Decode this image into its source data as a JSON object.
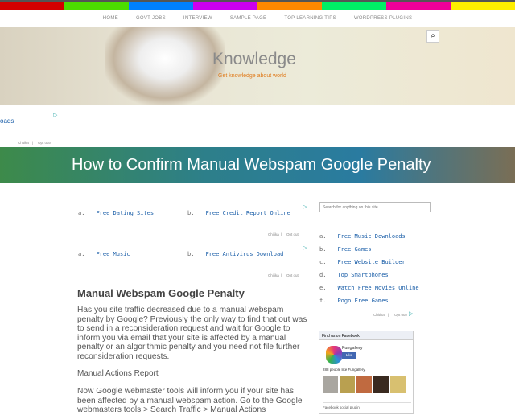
{
  "colorbar": [
    "#d40000",
    "#4cdd00",
    "#0080ff",
    "#cc00ee",
    "#ff8800",
    "#00ee66",
    "#ee0099",
    "#ffee00"
  ],
  "nav": [
    "HOME",
    "GOVT JOBS",
    "INTERVIEW",
    "SAMPLE PAGE",
    "TOP LEARNING TIPS",
    "WORDPRESS PLUGINS"
  ],
  "header": {
    "title": "Knowledge",
    "tagline": "Get knowledge about world",
    "search_icon": "search-icon"
  },
  "top_ad": {
    "text": "oads",
    "chitika": "Chitika",
    "optout": "Opt out!"
  },
  "banner": "How to Confirm Manual Webspam Google Penalty",
  "ads1": [
    {
      "k": "a.",
      "v": "Free Dating Sites"
    },
    {
      "k": "b.",
      "v": "Free Credit Report Online"
    }
  ],
  "ads2": [
    {
      "k": "a.",
      "v": "Free Music"
    },
    {
      "k": "b.",
      "v": "Free Antivirus Download"
    }
  ],
  "chitika": "Chitika",
  "sep": "|",
  "optout": "Opt out!",
  "article": {
    "heading": "Manual Webspam Google Penalty",
    "p1": "Has you site traffic decreased due to a manual webspam penalty by Google? Previously the only way to find that out was to send in a reconsideration request and wait for Google to inform you via email that your site is affected by a manual penalty or an algorithmic penalty and you need not file further reconsideration requests.",
    "subheading": "Manual Actions Report",
    "p2": "Now Google webmaster tools will inform you if your site has been affected by a manual webspam action. Go to the Google webmasters tools > Search Traffic > Manual Actions"
  },
  "sidebar": {
    "search_placeholder": "Search for anything on this site...",
    "ads": [
      {
        "k": "a.",
        "v": "Free Music Downloads"
      },
      {
        "k": "b.",
        "v": "Free Games"
      },
      {
        "k": "c.",
        "v": "Free Website Builder"
      },
      {
        "k": "d.",
        "v": "Top Smartphones"
      },
      {
        "k": "e.",
        "v": "Watch Free Movies Online"
      },
      {
        "k": "f.",
        "v": "Pogo Free Games"
      }
    ],
    "facebook": {
      "head": "Find us on Facebook",
      "name": "Fungallery",
      "like": "Like",
      "count": "288 people like Fungallery.",
      "footer": "Facebook social plugin"
    }
  }
}
